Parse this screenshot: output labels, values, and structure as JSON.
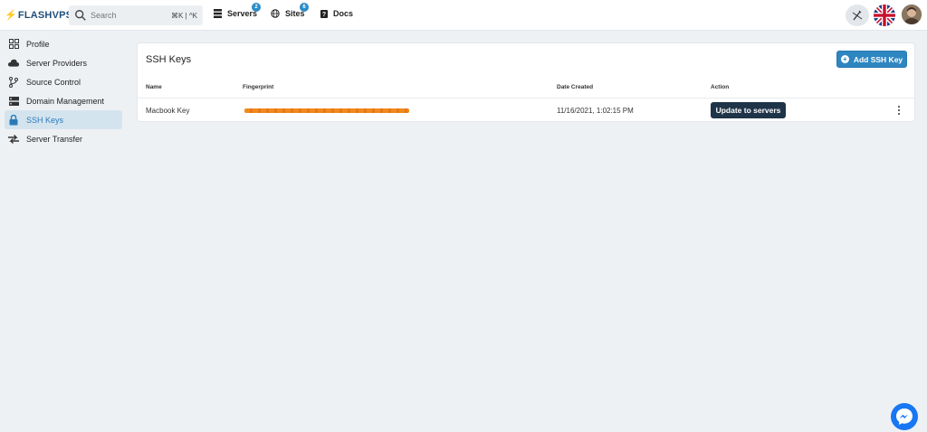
{
  "brand": {
    "name": "FLASHVPS",
    "accent": "#f0a81c",
    "color": "#1f4e79"
  },
  "search": {
    "placeholder": "Search",
    "shortcut": "⌘K | ^K"
  },
  "nav": {
    "servers": {
      "label": "Servers",
      "count": "2",
      "icon": "server-stack-icon"
    },
    "sites": {
      "label": "Sites",
      "count": "6",
      "icon": "globe-icon"
    },
    "docs": {
      "label": "Docs",
      "icon": "help-book-icon"
    }
  },
  "sidebar": {
    "items": [
      {
        "label": "Profile",
        "icon": "grid-icon"
      },
      {
        "label": "Server Providers",
        "icon": "cloud-icon"
      },
      {
        "label": "Source Control",
        "icon": "git-branch-icon"
      },
      {
        "label": "Domain Management",
        "icon": "server-rack-icon"
      },
      {
        "label": "SSH Keys",
        "icon": "lock-icon",
        "active": true
      },
      {
        "label": "Server Transfer",
        "icon": "transfer-arrows-icon"
      }
    ]
  },
  "main": {
    "title": "SSH Keys",
    "add_button": "Add SSH Key",
    "table": {
      "columns": [
        "Name",
        "Fingerprint",
        "Date Created",
        "Action"
      ],
      "rows": [
        {
          "name": "Macbook Key",
          "fingerprint": "",
          "date": "11/16/2021, 1:02:15 PM",
          "action": "Update to servers"
        }
      ]
    }
  },
  "colors": {
    "primary": "#2e86c1",
    "dark_button": "#1f3448",
    "active_bg": "#d4e4ef"
  }
}
